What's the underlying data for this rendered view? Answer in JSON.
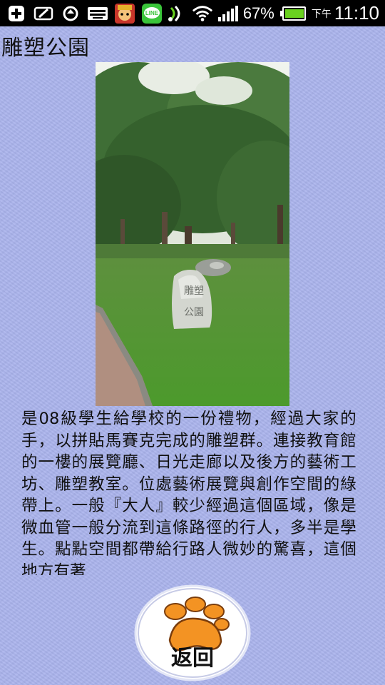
{
  "status_bar": {
    "battery_percent": "67%",
    "ampm": "下午",
    "time": "11:10",
    "icons": [
      "plus-notification-icon",
      "pen-notification-icon",
      "sync-icon",
      "keyboard-icon",
      "game-app-icon",
      "line-app-icon",
      "nfc-icon",
      "wifi-icon",
      "signal-icon",
      "battery-icon"
    ]
  },
  "page": {
    "title": "雕塑公園",
    "photo_alt": "雕塑公園"
  },
  "description": "是08級學生給學校的一份禮物，經過大家的手，以拼貼馬賽克完成的雕塑群。連接教育館的一樓的展覽廳、日光走廊以及後方的藝術工坊、雕塑教室。位處藝術展覽與創作空間的綠帶上。一般『大人』較少經過這個區域，像是微血管一般分流到這條路徑的行人，多半是學生。點點空間都帶給行路人微妙的驚喜，這個地方有著",
  "back_button": {
    "label": "返回"
  },
  "colors": {
    "background": "#a9b2ec",
    "paw": "#f39323",
    "statusbar": "#000000",
    "battery": "#6ad21f"
  }
}
